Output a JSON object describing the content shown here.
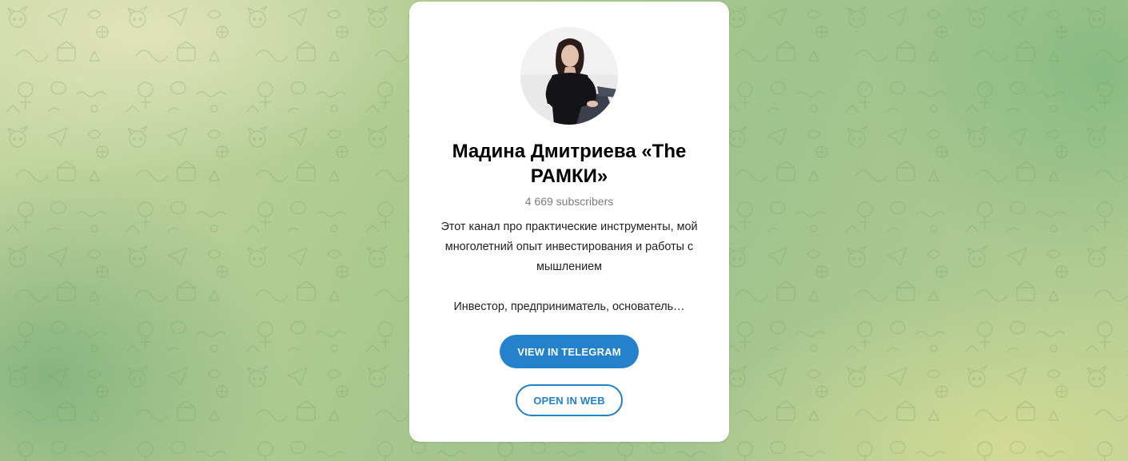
{
  "channel": {
    "title": "Мадина Дмитриева «The РАМКИ»",
    "subscribers": "4 669 subscribers",
    "description_line1": "Этот канал про практические инструменты, мой многолетний опыт инвестирования и работы с мышлением",
    "description_line2": "Инвестор, предприниматель, основатель…"
  },
  "buttons": {
    "view_in_telegram": "VIEW IN TELEGRAM",
    "open_in_web": "OPEN IN WEB"
  },
  "colors": {
    "accent": "#2481cc",
    "card_background": "#ffffff",
    "background_green": "#a9c98e"
  },
  "icons": {
    "avatar": "channel-avatar-photo",
    "background": "telegram-doodle-pattern"
  }
}
